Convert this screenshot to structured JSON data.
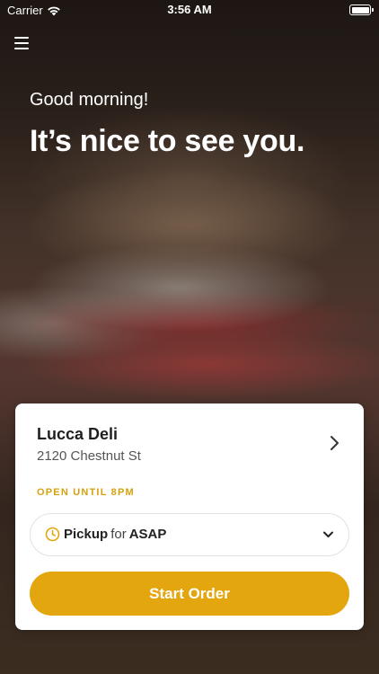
{
  "status_bar": {
    "carrier": "Carrier",
    "time": "3:56 AM"
  },
  "hero": {
    "greeting": "Good morning!",
    "headline": "It’s nice to see you."
  },
  "store": {
    "name": "Lucca Deli",
    "address": "2120 Chestnut St",
    "open_status": "OPEN UNTIL 8PM"
  },
  "order_mode": {
    "mode": "Pickup",
    "connector": "for",
    "time": "ASAP"
  },
  "actions": {
    "start_order_label": "Start Order"
  },
  "colors": {
    "accent": "#e3a60e",
    "open_status": "#d4a20f"
  },
  "icons": [
    "wifi-icon",
    "battery-icon",
    "menu-icon",
    "chevron-right-icon",
    "clock-icon",
    "chevron-down-icon"
  ]
}
